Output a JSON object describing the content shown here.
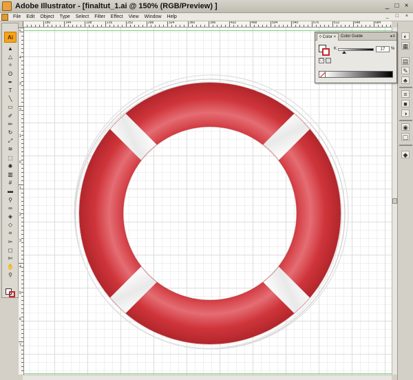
{
  "window": {
    "title": "Adobe Illustrator - [finaltut_1.ai @ 150% (RGB/Preview) ]",
    "controls": [
      "_",
      "□",
      "×"
    ]
  },
  "menubar": {
    "items": [
      "File",
      "Edit",
      "Object",
      "Type",
      "Select",
      "Filter",
      "Effect",
      "View",
      "Window",
      "Help"
    ],
    "doc_controls": "_ □ ×"
  },
  "ruler": {
    "h_labels": [
      "180",
      "144",
      "108",
      "216",
      "252",
      "288",
      "324",
      "360",
      "396",
      "432",
      "468",
      "504",
      "540",
      "576",
      "612",
      "648",
      "684"
    ],
    "v_labels": [
      "5",
      "4",
      "3",
      "2",
      "1",
      "0",
      "1",
      "2",
      "3",
      "4",
      "5",
      "6",
      "7"
    ]
  },
  "toolbar": {
    "logo": "Ai",
    "tools": [
      "selection-tool",
      "direct-selection-tool",
      "magic-wand-tool",
      "lasso-tool",
      "pen-tool",
      "type-tool",
      "line-tool",
      "rectangle-tool",
      "paintbrush-tool",
      "pencil-tool",
      "rotate-tool",
      "scale-tool",
      "warp-tool",
      "free-transform-tool",
      "symbol-sprayer-tool",
      "column-graph-tool",
      "mesh-tool",
      "gradient-tool",
      "eyedropper-tool",
      "blend-tool",
      "live-paint-tool",
      "live-paint-selection-tool",
      "crop-tool",
      "slice-tool",
      "eraser-tool",
      "scissors-tool",
      "hand-tool",
      "zoom-tool"
    ]
  },
  "color_panel": {
    "tabs": [
      "Color",
      "Color Guide"
    ],
    "channel_label": "K",
    "value": "17",
    "unit": "%",
    "k_level": 0.17
  },
  "colors": {
    "ring_red": "#c8353a",
    "ring_highlight": "#e56a70",
    "band_white": "#f4f4f4",
    "artboard_guide": "#7fd27f"
  }
}
